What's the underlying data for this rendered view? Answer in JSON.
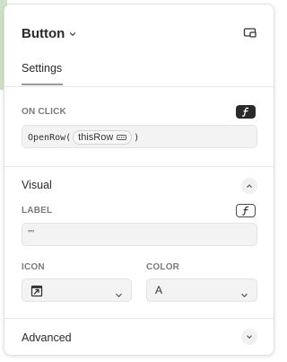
{
  "header": {
    "title": "Button",
    "tab_settings": "Settings"
  },
  "onclick": {
    "label": "ON CLICK",
    "code_prefix": "OpenRow(",
    "token": "thisRow",
    "code_suffix": ")"
  },
  "visual": {
    "title": "Visual",
    "label_label": "LABEL",
    "label_value": "\"\"",
    "icon_label": "ICON",
    "color_label": "COLOR",
    "color_value": "A"
  },
  "advanced": {
    "title": "Advanced"
  },
  "icons": {
    "title_chevron": "chevron-down-icon",
    "header_action": "screen-share-icon",
    "formula": "formula-icon",
    "token_menu": "ellipsis-icon",
    "collapse": "chevron-up-icon",
    "icon_value": "open-external-icon",
    "expand": "chevron-down-icon"
  },
  "colors": {
    "badge_dark": "#2a2a2a",
    "field_bg": "#f3f3f3",
    "divider": "#e6e6e6"
  }
}
